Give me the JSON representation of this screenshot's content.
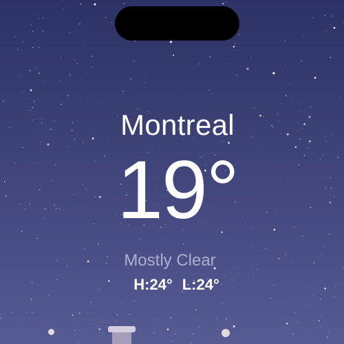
{
  "weather": {
    "city": "Montreal",
    "temperature": "19°",
    "condition": "Mostly Clear",
    "high": "H:24°",
    "low": "L:24°"
  },
  "background": {
    "sky_color": "#3f4377"
  }
}
